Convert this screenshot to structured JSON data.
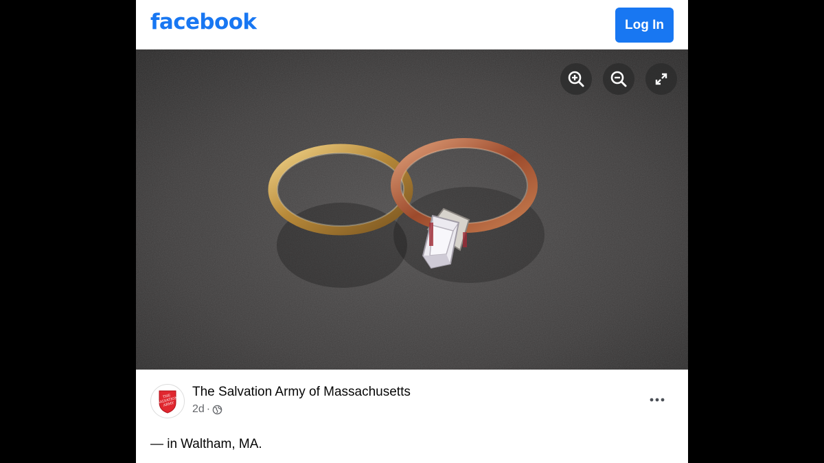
{
  "header": {
    "logo_text": "facebook",
    "login_label": "Log In",
    "brand_color": "#1877f2"
  },
  "photo": {
    "controls": [
      {
        "name": "zoom-in",
        "icon": "zoom-in-icon"
      },
      {
        "name": "zoom-out",
        "icon": "zoom-out-icon"
      },
      {
        "name": "expand",
        "icon": "expand-icon"
      }
    ]
  },
  "post": {
    "author": "The Salvation Army of Massachusetts",
    "avatar_text": "THE SALVATION ARMY",
    "time": "2d",
    "separator": "·",
    "privacy_icon": "globe-icon",
    "more_icon": "more-horizontal-icon",
    "caption_prefix": "— in",
    "location": "Waltham, MA."
  }
}
